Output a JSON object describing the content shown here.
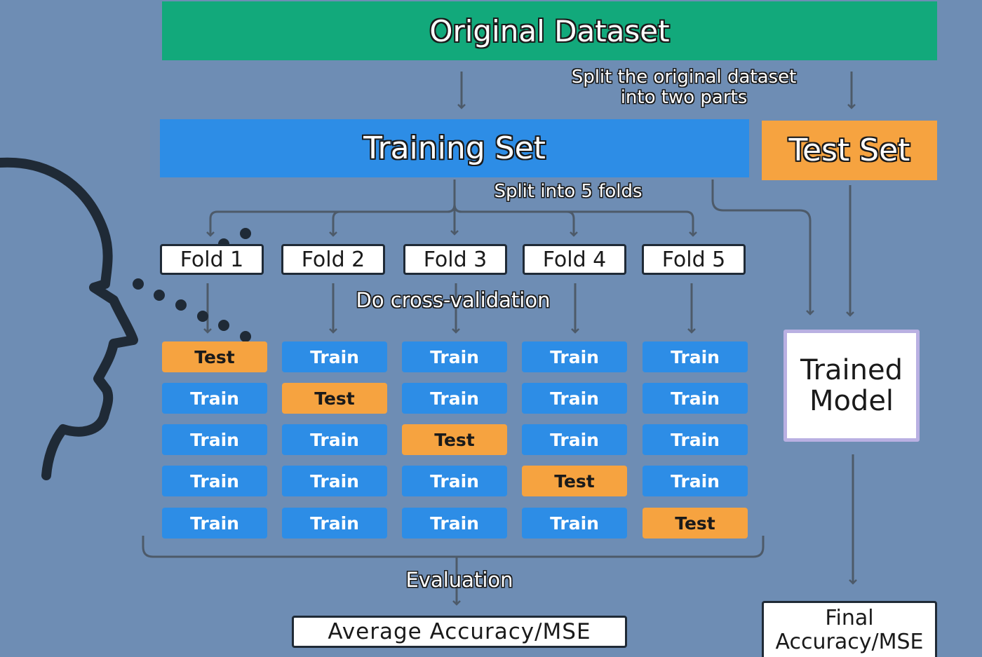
{
  "header": {
    "title": "Original Dataset"
  },
  "split_note": {
    "line1": "Split the original dataset",
    "line2": "into two parts"
  },
  "training_set": {
    "label": "Training Set"
  },
  "test_set": {
    "label": "Test Set"
  },
  "folds_note": "Split into 5 folds",
  "folds": [
    "Fold 1",
    "Fold 2",
    "Fold 3",
    "Fold 4",
    "Fold 5"
  ],
  "cv_note": "Do cross-validation",
  "grid": [
    [
      "Test",
      "Train",
      "Train",
      "Train",
      "Train"
    ],
    [
      "Train",
      "Test",
      "Train",
      "Train",
      "Train"
    ],
    [
      "Train",
      "Train",
      "Test",
      "Train",
      "Train"
    ],
    [
      "Train",
      "Train",
      "Train",
      "Test",
      "Train"
    ],
    [
      "Train",
      "Train",
      "Train",
      "Train",
      "Test"
    ]
  ],
  "evaluation_label": "Evaluation",
  "average_box": "Average Accuracy/MSE",
  "trained_model": {
    "line1": "Trained",
    "line2": "Model"
  },
  "final_box": {
    "line1": "Final",
    "line2": "Accuracy/MSE"
  },
  "colors": {
    "background": "#6e8db4",
    "original_dataset": "#12a97b",
    "training_set": "#2d8de6",
    "test_set": "#f6a340",
    "train_cell": "#2d8de6",
    "test_cell": "#f6a340",
    "trained_model_border": "#b9b0e2",
    "connector": "#4d5a69",
    "head_outline": "#1f2a36"
  },
  "icons": [
    "head-profile-icon",
    "dotted-speech-icon"
  ]
}
